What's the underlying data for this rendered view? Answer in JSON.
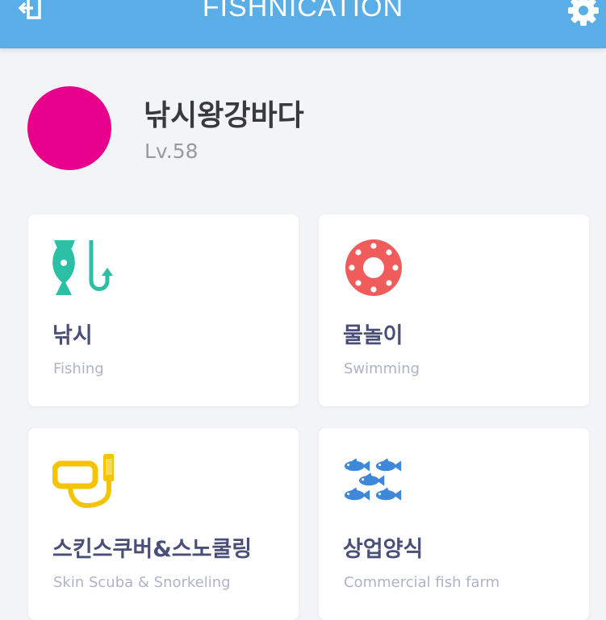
{
  "app": {
    "title": "FISHNICATION"
  },
  "header": {
    "back_icon": "exit-icon",
    "settings_icon": "gear-icon",
    "color": "#5aaee8"
  },
  "profile": {
    "name": "낚시왕강바다",
    "level": "Lv.58",
    "avatar_color": "#e8008c"
  },
  "categories": [
    {
      "title": "낚시",
      "subtitle": "Fishing",
      "icon": "fish-hook-icon"
    },
    {
      "title": "물놀이",
      "subtitle": "Swimming",
      "icon": "lifebuoy-icon"
    },
    {
      "title": "스킨스쿠버&스노쿨링",
      "subtitle": "Skin Scuba & Snorkeling",
      "icon": "snorkel-mask-icon"
    },
    {
      "title": "상업양식",
      "subtitle": "Commercial fish farm",
      "icon": "fish-school-icon"
    }
  ]
}
